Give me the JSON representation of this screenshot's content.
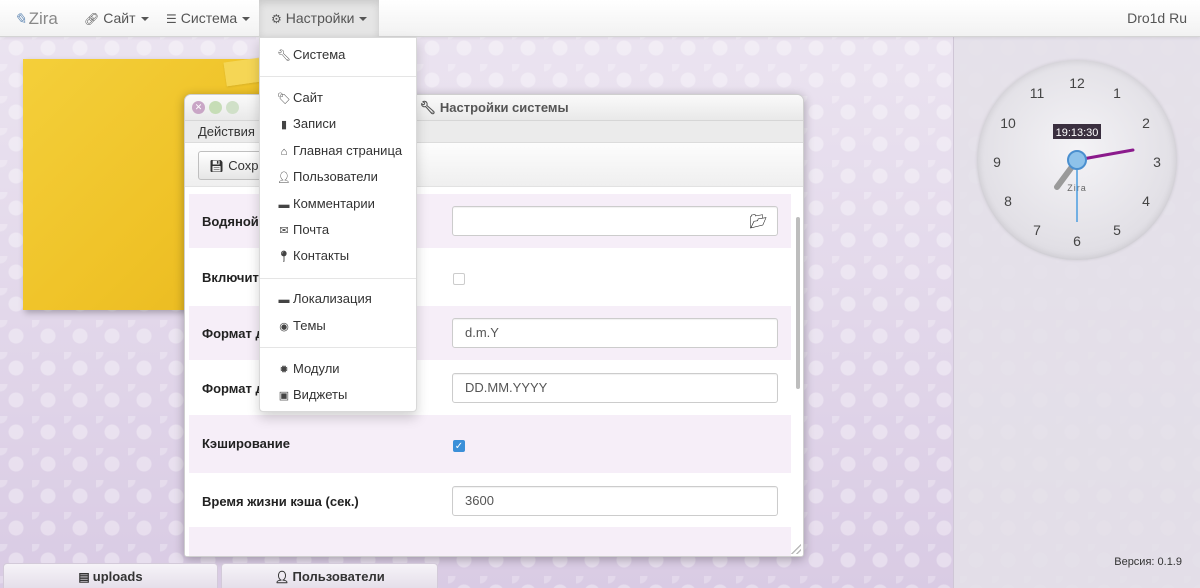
{
  "navbar": {
    "brand": "Zira",
    "items": [
      {
        "label": "Сайт",
        "icon": "link-icon"
      },
      {
        "label": "Система",
        "icon": "server-icon"
      },
      {
        "label": "Настройки",
        "icon": "gear-icon"
      }
    ],
    "user": "Dro1d Ru"
  },
  "dropdown": {
    "items": [
      {
        "label": "Система",
        "icon": "wrench-icon"
      },
      {
        "label": "Сайт",
        "icon": "tag-icon"
      },
      {
        "label": "Записи",
        "icon": "file-icon"
      },
      {
        "label": "Главная страница",
        "icon": "home-icon"
      },
      {
        "label": "Пользователи",
        "icon": "user-icon"
      },
      {
        "label": "Комментарии",
        "icon": "comment-icon"
      },
      {
        "label": "Почта",
        "icon": "envelope-icon"
      },
      {
        "label": "Контакты",
        "icon": "map-marker-icon"
      },
      {
        "label": "Локализация",
        "icon": "comment-icon"
      },
      {
        "label": "Темы",
        "icon": "eye-icon"
      },
      {
        "label": "Модули",
        "icon": "certificate-icon"
      },
      {
        "label": "Виджеты",
        "icon": "widget-icon"
      }
    ]
  },
  "window": {
    "title": "Настройки системы",
    "menu": "Действия",
    "save_label": "Сохра",
    "rows": [
      {
        "label": "Водяной",
        "type": "file",
        "value": ""
      },
      {
        "label": "Включить",
        "type": "checkbox",
        "checked": false
      },
      {
        "label": "Формат д",
        "type": "text",
        "value": "d.m.Y"
      },
      {
        "label": "Формат д",
        "type": "text",
        "value": "DD.MM.YYYY"
      },
      {
        "label": "Кэширование",
        "type": "checkbox",
        "checked": true
      },
      {
        "label": "Время жизни кэша (сек.)",
        "type": "text",
        "value": "3600"
      }
    ]
  },
  "clock": {
    "numbers": [
      "12",
      "1",
      "2",
      "3",
      "4",
      "5",
      "6",
      "7",
      "8",
      "9",
      "10",
      "11"
    ],
    "time": "19:13:30",
    "brand": "Zira",
    "colors": {
      "minute_hand": "#8b1a8c",
      "second_hand": "#4a9de0",
      "hour_hand": "#9a9a9a"
    }
  },
  "footer": {
    "version": "Версия: 0.1.9"
  },
  "taskbar": {
    "tabs": [
      {
        "label": "uploads",
        "icon": "hdd-icon"
      },
      {
        "label": "Пользователи",
        "icon": "user-icon"
      }
    ]
  }
}
